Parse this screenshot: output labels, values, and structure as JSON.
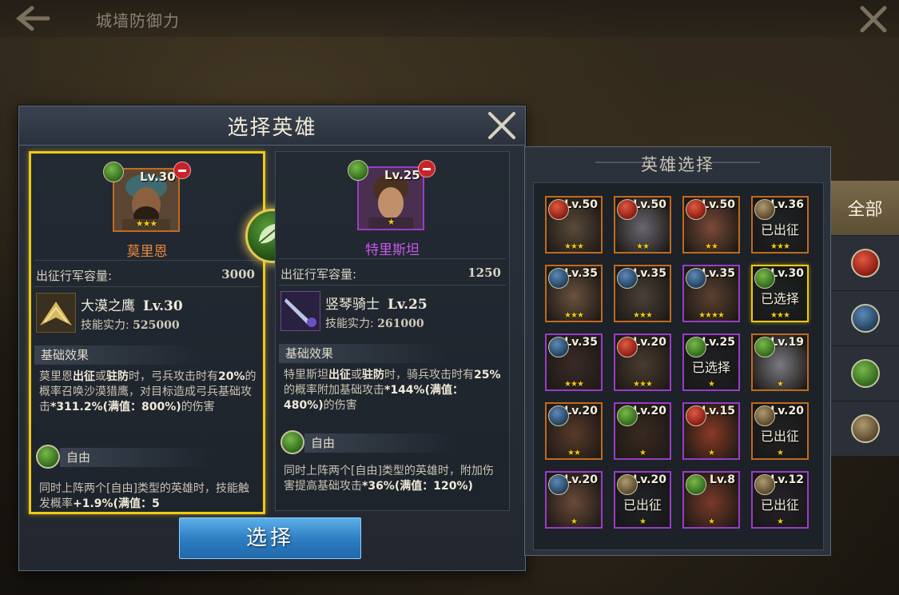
{
  "topbar": {
    "title": "城墙防御力"
  },
  "dialog": {
    "title": "选择英雄",
    "select_button": "选择"
  },
  "cards": [
    {
      "hero_name": "莫里恩",
      "level": "Lv.30",
      "stars": "★★★",
      "capacity_label": "出征行军容量:",
      "capacity_value": "3000",
      "skill_name": "大漠之鹰",
      "skill_level": "Lv.30",
      "skill_power_label": "技能实力:",
      "skill_power_value": "525000",
      "base_effect_title": "基础效果",
      "base_effect": {
        "p1": "莫里恩",
        "b1": "出征",
        "p2": "或",
        "b2": "驻防",
        "p3": "时，弓兵攻击时有",
        "b3": "20%",
        "p4": "的概率召唤沙漠猎鹰，对目标造成弓兵基础攻击",
        "b4": "*311.2%(满值：800%)",
        "p5": "的伤害"
      },
      "trait_title": "自由",
      "trait_desc_a": "同时上阵两个[自由]类型的英雄时，技能触发概率",
      "trait_desc_b": "+1.9%(满值：5"
    },
    {
      "hero_name": "特里斯坦",
      "level": "Lv.25",
      "stars": "★",
      "capacity_label": "出征行军容量:",
      "capacity_value": "1250",
      "skill_name": "竖琴骑士",
      "skill_level": "Lv.25",
      "skill_power_label": "技能实力:",
      "skill_power_value": "261000",
      "base_effect_title": "基础效果",
      "base_effect": {
        "p1": "特里斯坦",
        "b1": "出征",
        "p2": "或",
        "b2": "驻防",
        "p3": "时，骑兵攻击时有",
        "b3": "25%",
        "p4": "的概率附加基础攻击",
        "b4": "*144%(满值：480%)",
        "p5": "的伤害"
      },
      "trait_title": "自由",
      "trait_desc_a": "同时上阵两个[自由]类型的英雄时，附加伤害提高基础攻击",
      "trait_desc_b": "*36%(满值：120%)"
    }
  ],
  "hero_panel": {
    "title": "英雄选择",
    "tiles": [
      {
        "level": "Lv.50",
        "stars": "★★★",
        "class": "fire",
        "status": "",
        "quality": "orange"
      },
      {
        "level": "Lv.50",
        "stars": "★★",
        "class": "fire",
        "status": "",
        "quality": "orange"
      },
      {
        "level": "Lv.50",
        "stars": "★★",
        "class": "fire",
        "status": "",
        "quality": "orange"
      },
      {
        "level": "Lv.36",
        "stars": "★★★",
        "class": "hammer",
        "status": "已出征",
        "quality": "orange"
      },
      {
        "level": "Lv.35",
        "stars": "★★★",
        "class": "sword",
        "status": "",
        "quality": "orange"
      },
      {
        "level": "Lv.35",
        "stars": "★★★",
        "class": "sword",
        "status": "",
        "quality": "orange"
      },
      {
        "level": "Lv.35",
        "stars": "★★★★",
        "class": "sword",
        "status": "",
        "quality": "purple"
      },
      {
        "level": "Lv.30",
        "stars": "★★★",
        "class": "leaf",
        "status": "已选择",
        "quality": "chosen"
      },
      {
        "level": "Lv.35",
        "stars": "★★★",
        "class": "sword",
        "status": "",
        "quality": "purple"
      },
      {
        "level": "Lv.20",
        "stars": "★★★",
        "class": "fire",
        "status": "",
        "quality": "purple"
      },
      {
        "level": "Lv.25",
        "stars": "★",
        "class": "leaf",
        "status": "已选择",
        "quality": "purple"
      },
      {
        "level": "Lv.19",
        "stars": "★",
        "class": "leaf",
        "status": "",
        "quality": "orange"
      },
      {
        "level": "Lv.20",
        "stars": "★★",
        "class": "sword",
        "status": "",
        "quality": "orange"
      },
      {
        "level": "Lv.20",
        "stars": "★",
        "class": "leaf",
        "status": "",
        "quality": "purple"
      },
      {
        "level": "Lv.15",
        "stars": "★",
        "class": "fire",
        "status": "",
        "quality": "purple"
      },
      {
        "level": "Lv.20",
        "stars": "★",
        "class": "hammer",
        "status": "已出征",
        "quality": "orange"
      },
      {
        "level": "Lv.20",
        "stars": "★",
        "class": "sword",
        "status": "",
        "quality": "purple"
      },
      {
        "level": "Lv.20",
        "stars": "★",
        "class": "hammer",
        "status": "已出征",
        "quality": "purple"
      },
      {
        "level": "Lv.8",
        "stars": "★",
        "class": "leaf",
        "status": "",
        "quality": "purple"
      },
      {
        "level": "Lv.12",
        "stars": "★",
        "class": "hammer",
        "status": "已出征",
        "quality": "purple"
      }
    ]
  },
  "filters": {
    "all_label": "全部",
    "icons": [
      "fire-class-icon",
      "sword-class-icon",
      "leaf-class-icon",
      "hammer-class-icon"
    ]
  },
  "colors": {
    "selected_border": "#f0c814",
    "orange_quality": "#c06a20",
    "purple_quality": "#9a3cc8",
    "button_blue": "#2f7fc4",
    "name_orange": "#e8873a",
    "name_purple": "#c658e8",
    "bold_text": "#f0ead8"
  }
}
